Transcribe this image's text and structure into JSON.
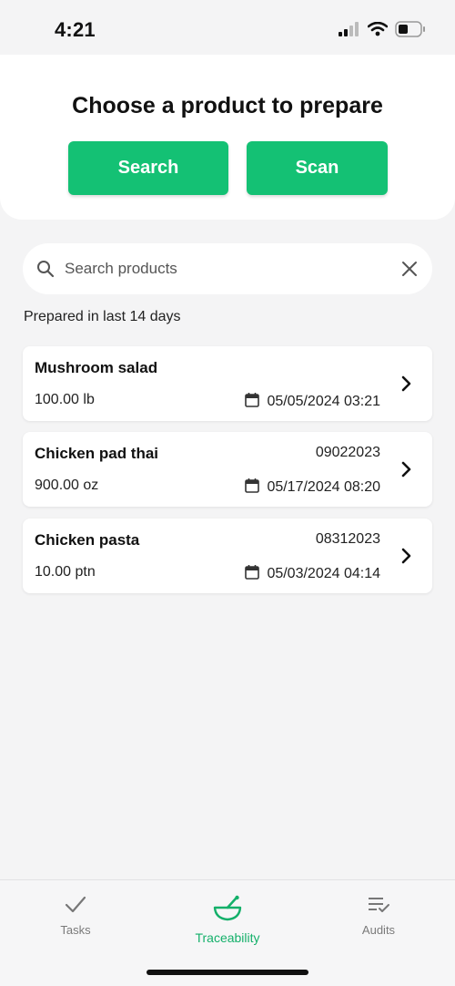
{
  "status_bar": {
    "time": "4:21"
  },
  "header": {
    "title": "Choose a product to prepare",
    "search_button": "Search",
    "scan_button": "Scan"
  },
  "search": {
    "placeholder": "Search products"
  },
  "section_label": "Prepared in last 14 days",
  "products": [
    {
      "name": "Mushroom salad",
      "code": "",
      "quantity": "100.00 lb",
      "date": "05/05/2024 03:21"
    },
    {
      "name": "Chicken pad thai",
      "code": "09022023",
      "quantity": "900.00 oz",
      "date": "05/17/2024 08:20"
    },
    {
      "name": "Chicken pasta",
      "code": "08312023",
      "quantity": "10.00 ptn",
      "date": "05/03/2024 04:14"
    }
  ],
  "tabs": {
    "tasks": "Tasks",
    "traceability": "Traceability",
    "audits": "Audits"
  },
  "colors": {
    "accent": "#14c174",
    "active_tab": "#14b06a"
  }
}
